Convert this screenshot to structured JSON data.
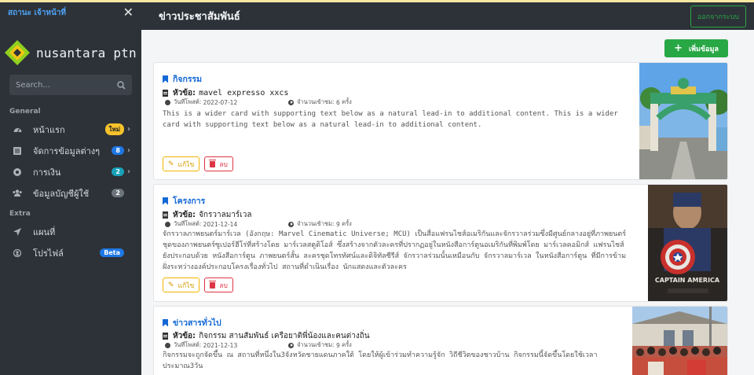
{
  "sidebar": {
    "status": "สถานะ เจ้าหน้าที่",
    "close_icon": "close-icon",
    "brand": "nusantara ptn",
    "search_placeholder": "Search...",
    "sections": [
      {
        "label": "General",
        "items": [
          {
            "label": "หน้าแรก",
            "icon": "dashboard-icon",
            "badge": "ใหม่",
            "badge_color": "#f5c22b",
            "chevron": true
          },
          {
            "label": "จัดการข้อมูลต่างๆ",
            "icon": "list-icon",
            "badge": "8",
            "badge_color": "#1e78e6",
            "chevron": true
          },
          {
            "label": "การเงิน",
            "icon": "coin-icon",
            "badge": "2",
            "badge_color": "#17a2b8",
            "chevron": true
          },
          {
            "label": "ข้อมูลบัญชีผู้ใช้",
            "icon": "users-icon",
            "badge": "2",
            "badge_color": "#6c757d",
            "chevron": false
          }
        ]
      },
      {
        "label": "Extra",
        "items": [
          {
            "label": "แผนที่",
            "icon": "location-arrow-icon"
          },
          {
            "label": "โปรไฟล์",
            "icon": "profile-icon",
            "badge": "Beta",
            "badge_color": "#1e78e6"
          }
        ]
      }
    ]
  },
  "header": {
    "title": "ข่าวประชาสัมพันธ์",
    "logout_label": "ออกจากระบบ"
  },
  "main": {
    "add_label": "เพิ่มข้อมูล",
    "subject_label": "หัวข้อ:",
    "date_label": "วันที่โพสต์:",
    "views_label": "จำนวนเข้าชม:",
    "views_unit": "ครั้ง",
    "edit_label": "แก้ไข",
    "delete_label": "ลบ",
    "posts": [
      {
        "category": "กิจกรรม",
        "subject": "mavel expresso xxcs",
        "date": "2022-07-12",
        "views": "6",
        "description": "This is a wider card with supporting text below as a natural lead-in to additional content. This is a wider card with supporting text below as a natural lead-in to additional content."
      },
      {
        "category": "โครงการ",
        "subject": "จักรวาลมาร์เวล",
        "date": "2021-12-14",
        "views": "9",
        "description": "จักรวาลภาพยนตร์มาร์เวล (อังกฤษ: Marvel Cinematic Universe; MCU) เป็นสื่อแฟรนไชส์อเมริกันและจักรวาลร่วมซึ่งมีศูนย์กลางอยู่ที่ภาพยนตร์ชุดของภาพยนตร์ซูเปอร์ฮีโร่ที่สร้างโดย มาร์เวลสตูดิโอส์ ซึ่งสร้างจากตัวละครที่ปรากฏอยู่ในหนังสือการ์ตูนอเมริกันที่พิมพ์โดย มาร์เวลคอมิกส์ แฟรนไชส์ยังประกอบด้วย หนังสือการ์ตูน ภาพยนตร์สั้น ละครชุดโทรทัศน์และดิจิทัลซีรีส์ จักรวาลร่วมนั้นเหมือนกับ จักรวาลมาร์เวล ในหนังสือการ์ตูน ที่มีการข้ามฝั่งระหว่างองค์ประกอบโครงเรื่องทั่วไป สถานที่ดำเนินเรื่อง นักแสดงและตัวละคร"
      },
      {
        "category": "ข่าวสารทั่วไป",
        "subject": "กิจกรรม สานสัมพันธ์ เครือยาติพี่น้องและคนต่างถิ่น",
        "date": "2021-12-13",
        "views": "9",
        "description": "กิจกรรมจะถูกจัดขึ้น ณ สถานที่หนึ่งใน3จังหวัดชายแดนภาคใต้ โดยให้ผู้เข้าร่วมทำความรู้จัก วิถีชีวิตของชาวบ้าน กิจกรรมนี้จัดขึ้นโดยใช้เวลาประมาณ3วัน"
      }
    ]
  },
  "colors": {
    "sidebar_bg": "#2d3238",
    "accent_blue": "#1569d6",
    "success": "#28a745",
    "warning": "#f0b400",
    "danger": "#dc3545"
  }
}
